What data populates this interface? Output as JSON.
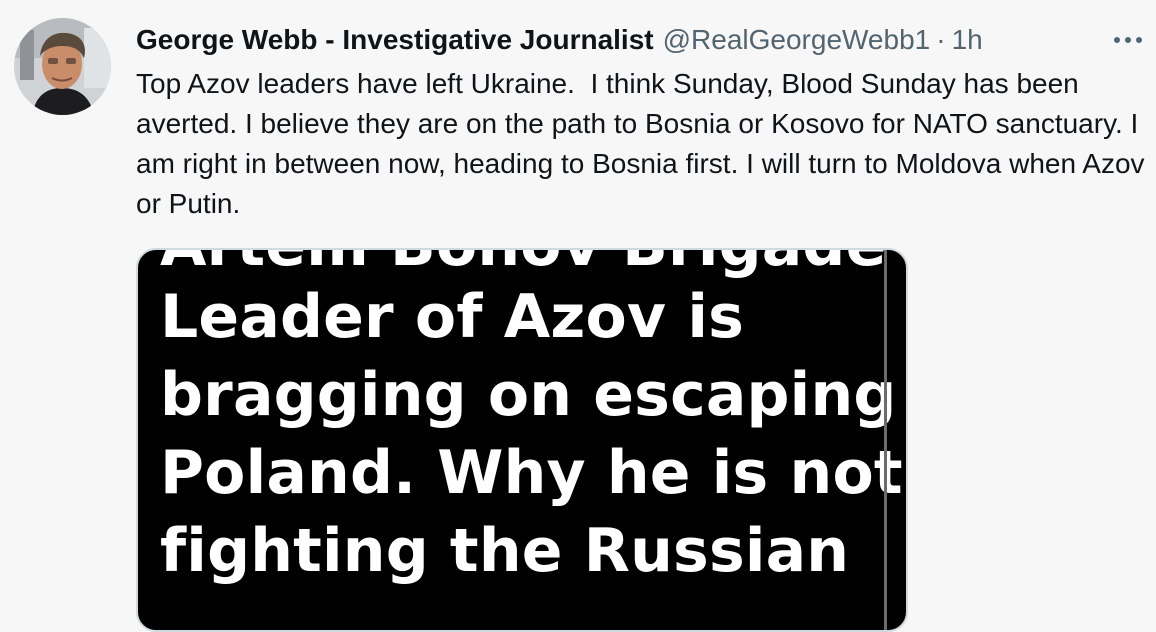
{
  "tweet": {
    "author": {
      "display_name": "George Webb - Investigative Journalist",
      "handle": "@RealGeorgeWebb1",
      "separator": "·",
      "time": "1h"
    },
    "more_icon": "more-horizontal-icon",
    "text": "Top Azov leaders have left Ukraine.  I think Sunday, Blood Sunday has been averted. I believe they are on the path to Bosnia or Kosovo for NATO sanctuary. I am right in between now, heading to Bosnia first. I will turn to Moldova when Azov or Putin.",
    "media": {
      "partial_top_line": "Artem Bonov Brigade",
      "lines": [
        "Leader of Azov is",
        "bragging on escaping to",
        "Poland. Why he is not",
        "fighting the Russian"
      ]
    }
  }
}
